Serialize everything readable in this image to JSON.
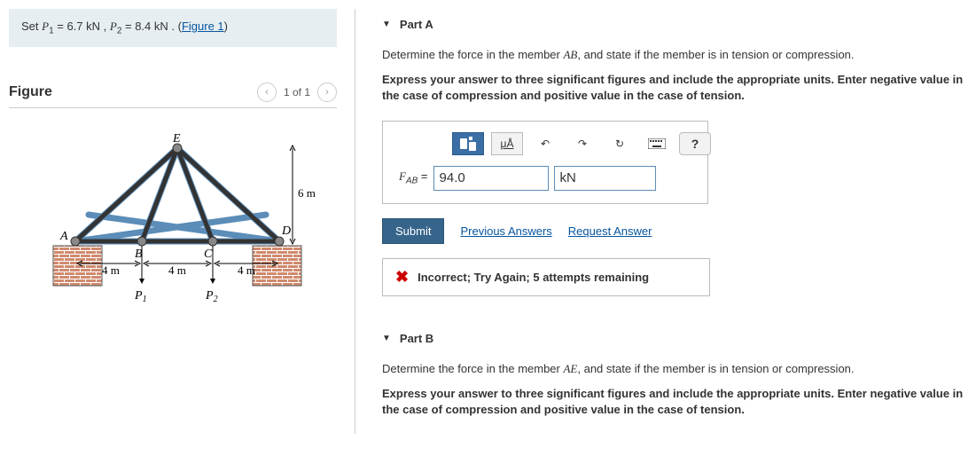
{
  "problem": {
    "prefix": "Set ",
    "p1_label": "P",
    "p1_sub": "1",
    "p1_eq": " = 6.7  kN",
    "sep": " , ",
    "p2_label": "P",
    "p2_sub": "2",
    "p2_eq": " = 8.4  kN",
    "suffix": " . (",
    "fig_link": "Figure 1",
    "close": ")"
  },
  "figure": {
    "heading": "Figure",
    "pager": "1 of 1"
  },
  "partA": {
    "title": "Part A",
    "instruct_pre": "Determine the force in the member ",
    "member": "AB",
    "instruct_post": ", and state if the member is in tension or compression.",
    "instruct_bold": "Express your answer to three significant figures and include the appropriate units. Enter negative value in the case of compression and positive value in the case of tension.",
    "toolbar": {
      "units": "μÅ",
      "help": "?"
    },
    "answer": {
      "label_F": "F",
      "label_sub": "AB",
      "eq": " = ",
      "value": "94.0",
      "unit": "kN"
    },
    "submit": "Submit",
    "prev": "Previous Answers",
    "req": "Request Answer",
    "feedback": "Incorrect; Try Again; 5 attempts remaining"
  },
  "partB": {
    "title": "Part B",
    "instruct_pre": "Determine the force in the member ",
    "member": "AE",
    "instruct_post": ", and state if the member is in tension or compression.",
    "instruct_bold": "Express your answer to three significant figures and include the appropriate units. Enter negative value in the case of compression and positive value in the case of tension."
  },
  "diagram": {
    "E": "E",
    "A": "A",
    "B": "B",
    "C": "C",
    "D": "D",
    "d1": "4 m",
    "d2": "4 m",
    "d3": "4 m",
    "h": "6 m",
    "P1": "P",
    "P1s": "1",
    "P2": "P",
    "P2s": "2"
  }
}
